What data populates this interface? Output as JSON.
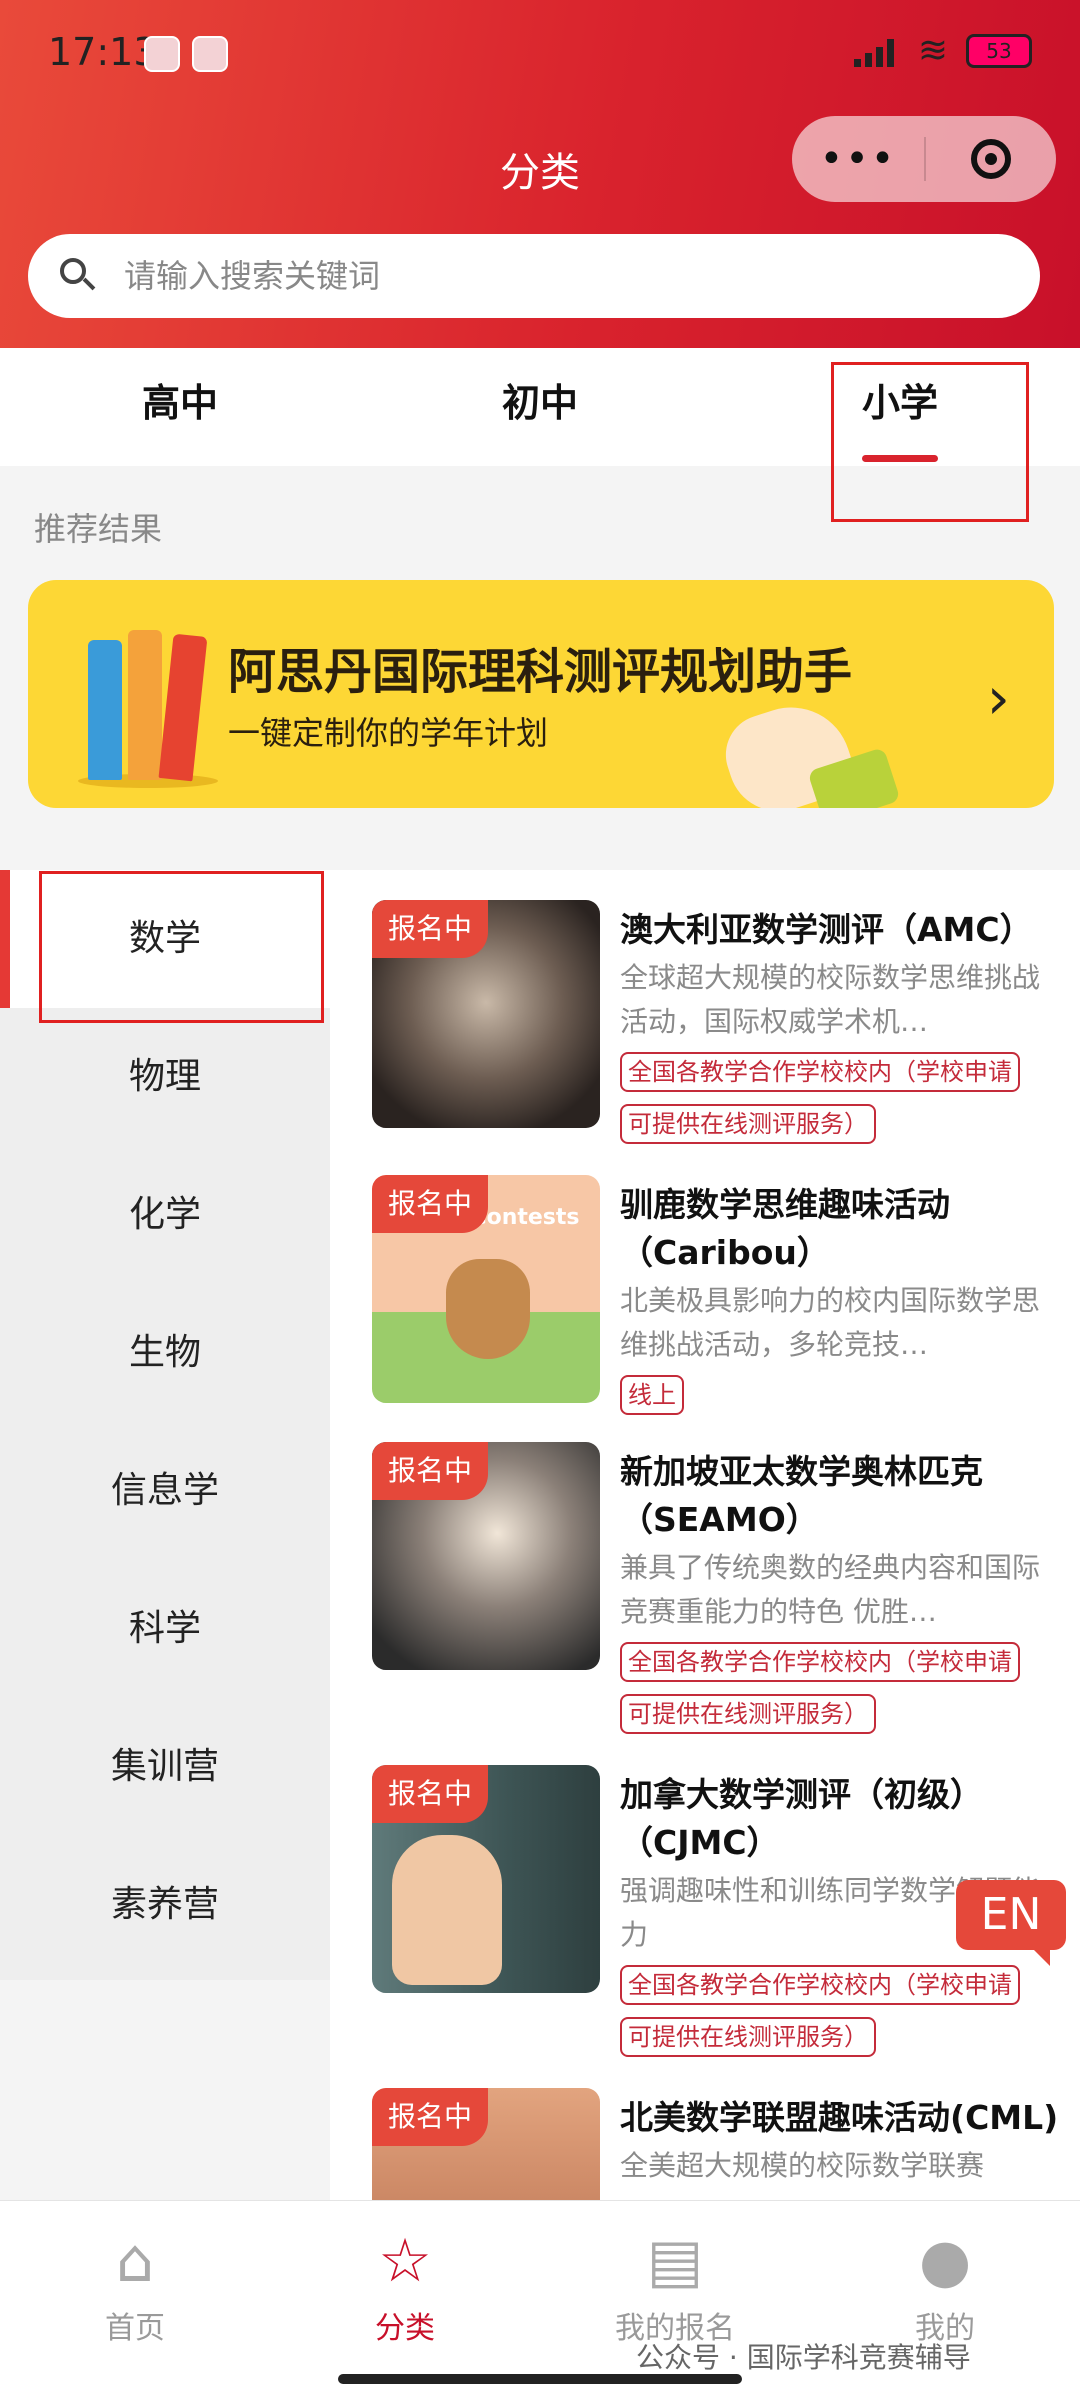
{
  "status_bar": {
    "time": "17:13",
    "battery": "53"
  },
  "header": {
    "title": "分类",
    "more_icon": "•••"
  },
  "search": {
    "placeholder": "请输入搜索关键词"
  },
  "tabs": [
    {
      "label": "高中"
    },
    {
      "label": "初中"
    },
    {
      "label": "小学",
      "active": true
    }
  ],
  "section_label": "推荐结果",
  "banner": {
    "title": "阿思丹国际理科测评规划助手",
    "subtitle": "一键定制你的学年计划",
    "chevron": "›"
  },
  "sidebar": {
    "items": [
      {
        "label": "数学",
        "active": true
      },
      {
        "label": "物理"
      },
      {
        "label": "化学"
      },
      {
        "label": "生物"
      },
      {
        "label": "信息学"
      },
      {
        "label": "科学"
      },
      {
        "label": "集训营"
      },
      {
        "label": "素养营"
      }
    ]
  },
  "courses": [
    {
      "badge": "报名中",
      "title": "澳大利亚数学测评（AMC）",
      "desc": "全球超大规模的校际数学思维挑战活动，国际权威学术机…",
      "tags": [
        "全国各教学合作学校校内（学校申请",
        "可提供在线测评服务）"
      ]
    },
    {
      "badge": "报名中",
      "title": "驯鹿数学思维趣味活动（Caribou）",
      "desc": "北美极具影响力的校内国际数学思维挑战活动，多轮竞技…",
      "tags": [
        "线上"
      ],
      "thumb_text": "ou Contests"
    },
    {
      "badge": "报名中",
      "title": "新加坡亚太数学奥林匹克（SEAMO）",
      "desc": "兼具了传统奥数的经典内容和国际竞赛重能力的特色 优胜…",
      "tags": [
        "全国各教学合作学校校内（学校申请",
        "可提供在线测评服务）"
      ]
    },
    {
      "badge": "报名中",
      "title": "加拿大数学测评（初级）（CJMC）",
      "desc": "强调趣味性和训练同学数学解题能力",
      "tags": [
        "全国各教学合作学校校内（学校申请",
        "可提供在线测评服务）"
      ]
    },
    {
      "badge": "报名中",
      "title": "北美数学联盟趣味活动(CML)",
      "desc": "全美超大规模的校际数学联赛",
      "tags": []
    }
  ],
  "floating": {
    "lang": "EN"
  },
  "tabbar": [
    {
      "label": "首页",
      "icon": "home-icon"
    },
    {
      "label": "分类",
      "icon": "star-icon",
      "active": true
    },
    {
      "label": "我的报名",
      "icon": "document-icon"
    },
    {
      "label": "我的",
      "icon": "user-icon"
    }
  ],
  "watermark": "公众号 · 国际学科竞赛辅导"
}
